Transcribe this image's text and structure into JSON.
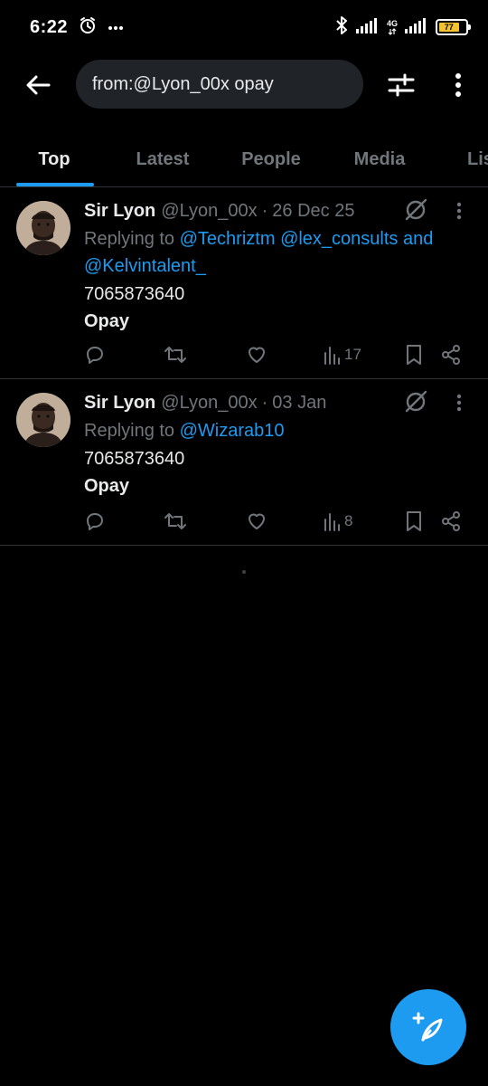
{
  "status_bar": {
    "time": "6:22",
    "network": "4G",
    "battery": "77"
  },
  "search": {
    "query": "from:@Lyon_00x opay"
  },
  "tabs": [
    {
      "label": "Top",
      "active": true
    },
    {
      "label": "Latest",
      "active": false
    },
    {
      "label": "People",
      "active": false
    },
    {
      "label": "Media",
      "active": false
    },
    {
      "label": "Lis",
      "active": false
    }
  ],
  "posts": [
    {
      "author": "Sir Lyon",
      "handle": "@Lyon_00x",
      "separator": "·",
      "date": "26 Dec 25",
      "replying_prefix": "Replying to",
      "mention_1": "@Techriztm",
      "mention_2": "@lex_consults",
      "mention_and": "and",
      "mention_3": "@Kelvintalent_",
      "line_1": "7065873640",
      "line_2": "Opay",
      "views": "17"
    },
    {
      "author": "Sir Lyon",
      "handle": "@Lyon_00x",
      "separator": "·",
      "date": "03 Jan",
      "replying_prefix": "Replying to",
      "mention_1": "@Wizarab10",
      "line_1": "7065873640",
      "line_2": "Opay",
      "views": "8"
    }
  ],
  "colors": {
    "accent": "#1d9bf0",
    "background": "#000000",
    "muted": "#71767b",
    "text": "#e7e9ea",
    "search_bg": "#202327",
    "battery": "#f2c230"
  },
  "icons": {
    "back": "arrow-left-icon",
    "filter": "sliders-icon",
    "more": "more-vertical-icon",
    "grok": "grok-icon",
    "reply": "reply-icon",
    "repost": "repost-icon",
    "like": "heart-icon",
    "views": "views-icon",
    "bookmark": "bookmark-icon",
    "share": "share-icon",
    "compose": "compose-icon"
  }
}
